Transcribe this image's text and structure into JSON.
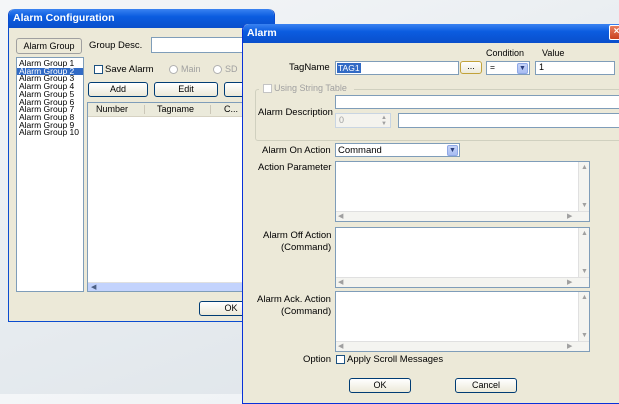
{
  "back_window": {
    "title": "Alarm Configuration",
    "alarm_group_button": "Alarm Group",
    "group_desc_label": "Group Desc.",
    "groups": [
      "Alarm Group 1",
      "Alarm Group 2",
      "Alarm Group 3",
      "Alarm Group 4",
      "Alarm Group 5",
      "Alarm Group 6",
      "Alarm Group 7",
      "Alarm Group 8",
      "Alarm Group 9",
      "Alarm Group 10"
    ],
    "selected_group_index": 1,
    "save_alarm_label": "Save Alarm",
    "radio_main": "Main",
    "radio_sd": "SD",
    "add_button": "Add",
    "edit_button": "Edit",
    "columns": [
      "Number",
      "Tagname",
      "C..."
    ],
    "ok_button": "OK"
  },
  "alarm_dialog": {
    "title": "Alarm",
    "condition_header": "Condition",
    "value_header": "Value",
    "tagname_label": "TagName",
    "tagname_value": "TAG1",
    "browse_button": "...",
    "condition_value": "=",
    "value_value": "1",
    "using_string_table": "Using String Table",
    "alarm_description_label": "Alarm Description",
    "spin_value": "0",
    "alarm_on_action_label": "Alarm On Action",
    "alarm_on_action_value": "Command",
    "action_parameter_label": "Action Parameter",
    "alarm_off_action_label": "Alarm Off Action",
    "alarm_off_action_sub": "(Command)",
    "alarm_ack_action_label": "Alarm Ack. Action",
    "alarm_ack_action_sub": "(Command)",
    "option_label": "Option",
    "apply_scroll_label": "Apply Scroll Messages",
    "ok_button": "OK",
    "cancel_button": "Cancel",
    "colors": {
      "title_blue": "#0a4fcb",
      "selection": "#316ac5",
      "face": "#ece9d8"
    }
  }
}
